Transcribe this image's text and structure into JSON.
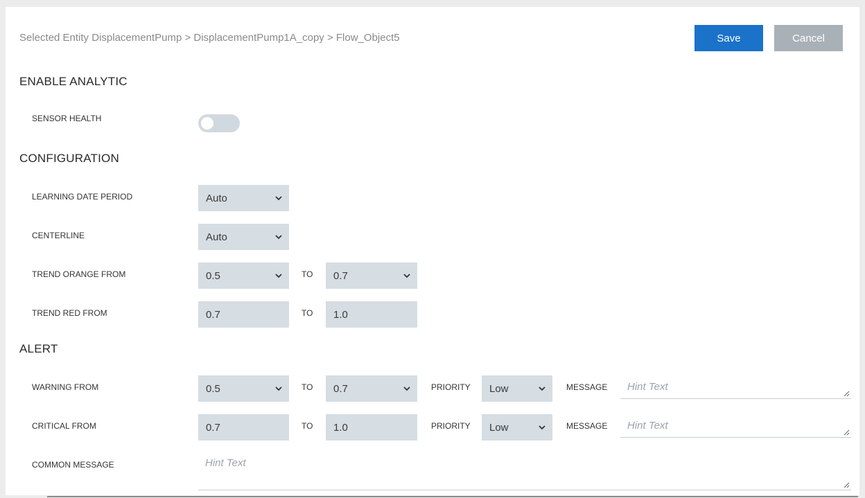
{
  "breadcrumb": "Selected Entity DisplacementPump > DisplacementPump1A_copy > Flow_Object5",
  "buttons": {
    "save": "Save",
    "cancel": "Cancel"
  },
  "sections": {
    "enable_analytic": "ENABLE ANALYTIC",
    "configuration": "CONFIGURATION",
    "alert": "ALERT"
  },
  "enable": {
    "sensor_health_label": "SENSOR HEALTH",
    "sensor_health_on": false
  },
  "config": {
    "learning_label": "LEARNING DATE PERIOD",
    "learning_value": "Auto",
    "centerline_label": "CENTERLINE",
    "centerline_value": "Auto",
    "trend_orange_label": "TREND ORANGE FROM",
    "trend_orange_from": "0.5",
    "trend_orange_to": "0.7",
    "trend_red_label": "TREND RED FROM",
    "trend_red_from": "0.7",
    "trend_red_to": "1.0",
    "to_label": "TO"
  },
  "alert": {
    "warning_label": "WARNING FROM",
    "warning_from": "0.5",
    "warning_to": "0.7",
    "warning_priority": "Low",
    "critical_label": "CRITICAL FROM",
    "critical_from": "0.7",
    "critical_to": "1.0",
    "critical_priority": "Low",
    "to_label": "TO",
    "priority_label": "PRIORITY",
    "message_label": "MESSAGE",
    "hint_text": "Hint Text",
    "common_message_label": "COMMON MESSAGE"
  },
  "icons": {
    "dropdown": "chevron-down-icon",
    "resize": "resize-handle-icon"
  },
  "colors": {
    "primary": "#1a72c9",
    "secondary": "#a9b1b8",
    "field_bg": "#d6dde3"
  }
}
